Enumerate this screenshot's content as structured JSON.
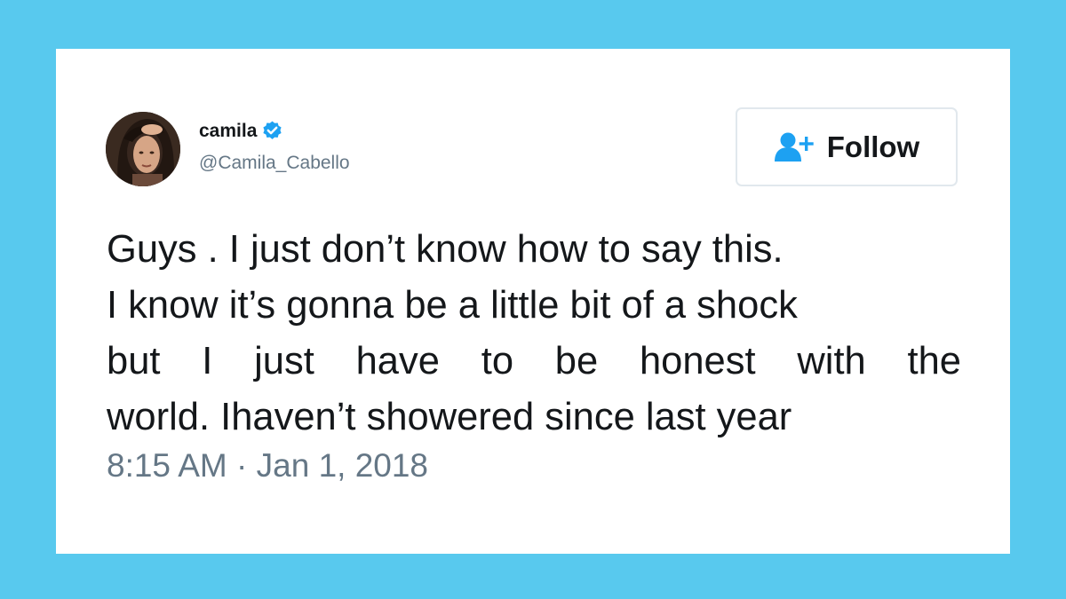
{
  "user": {
    "display_name": "camila",
    "handle": "@Camila_Cabello",
    "verified": true
  },
  "follow_button": {
    "label": "Follow",
    "icon": "add-user-icon"
  },
  "tweet": {
    "lines": [
      "Guys . I just don’t know how to say this.",
      "I know it’s gonna be a little bit of a shock",
      "but I just have to be honest with the",
      "world. Ihaven’t showered since last year"
    ],
    "timestamp": "8:15 AM · Jan 1, 2018"
  },
  "colors": {
    "background": "#58c9ee",
    "card": "#ffffff",
    "verified_badge": "#1da1f2",
    "text_primary": "#14171a",
    "text_secondary": "#657786",
    "button_border": "#e1e8ed"
  }
}
